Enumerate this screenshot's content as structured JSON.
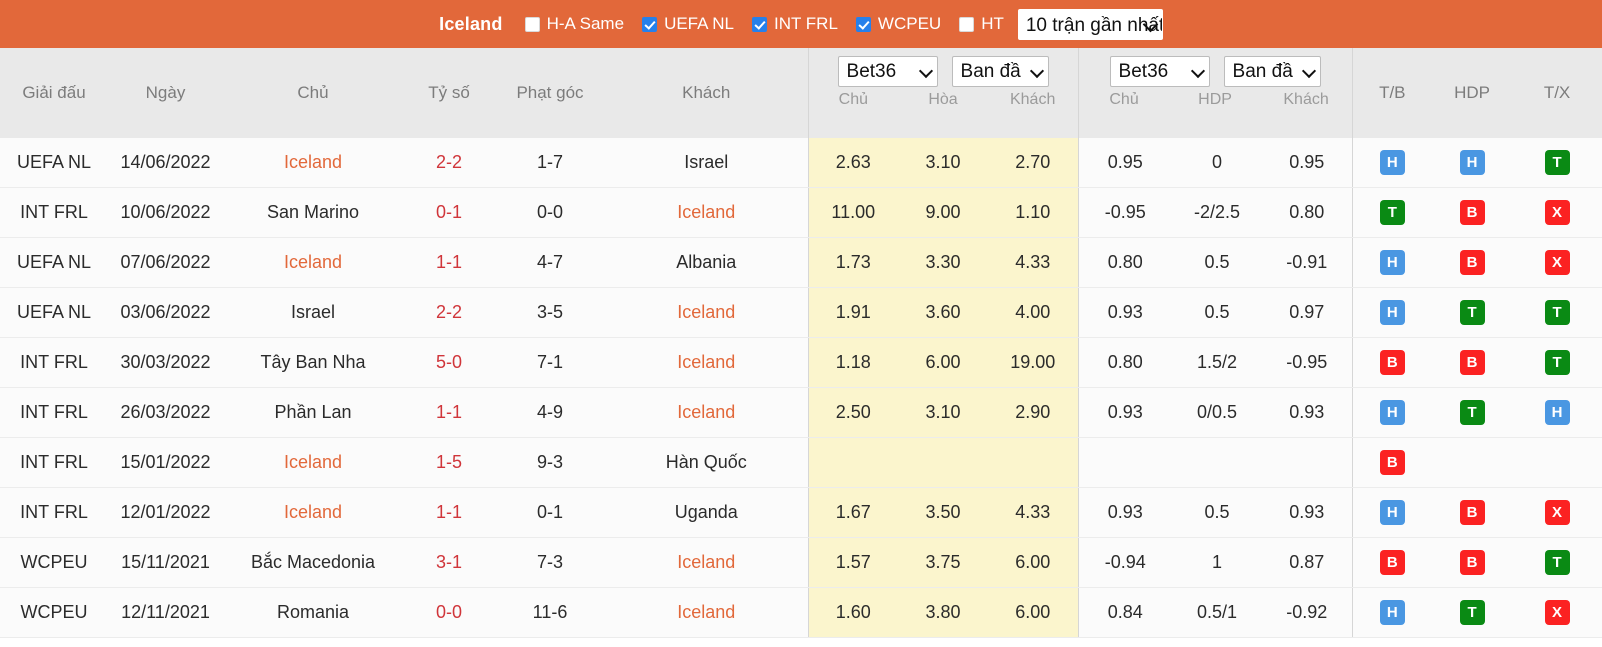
{
  "topbar": {
    "team": "Iceland",
    "filters": [
      {
        "label": "H-A Same",
        "checked": false
      },
      {
        "label": "UEFA NL",
        "checked": true
      },
      {
        "label": "INT FRL",
        "checked": true
      },
      {
        "label": "WCPEU",
        "checked": true
      },
      {
        "label": "HT",
        "checked": false
      }
    ],
    "range_select": "10 trận gần nhất"
  },
  "table": {
    "headers": {
      "league": "Giải đấu",
      "date": "Ngày",
      "home": "Chủ",
      "score": "Tỷ số",
      "corner": "Phạt góc",
      "away": "Khách",
      "tb": "T/B",
      "hdp_res": "HDP",
      "tx": "T/X"
    },
    "group1": {
      "bookmaker": "Bet36",
      "period": "Ban đầ",
      "sub": [
        "Chủ",
        "Hòa",
        "Khách"
      ]
    },
    "group2": {
      "bookmaker": "Bet36",
      "period": "Ban đầ",
      "sub": [
        "Chủ",
        "HDP",
        "Khách"
      ]
    },
    "rows": [
      {
        "league": "UEFA NL",
        "date": "14/06/2022",
        "home": "Iceland",
        "home_hi": true,
        "score": "2-2",
        "corner": "1-7",
        "away": "Israel",
        "away_hi": false,
        "o1": "2.63",
        "ox": "3.10",
        "o2": "2.70",
        "h1": "0.95",
        "hdp": "0",
        "h2": "0.95",
        "tb": "H",
        "hdp_res": "H",
        "tx": "T"
      },
      {
        "league": "INT FRL",
        "date": "10/06/2022",
        "home": "San Marino",
        "home_hi": false,
        "score": "0-1",
        "corner": "0-0",
        "away": "Iceland",
        "away_hi": true,
        "o1": "11.00",
        "ox": "9.00",
        "o2": "1.10",
        "h1": "-0.95",
        "hdp": "-2/2.5",
        "h2": "0.80",
        "tb": "T",
        "hdp_res": "B",
        "tx": "X"
      },
      {
        "league": "UEFA NL",
        "date": "07/06/2022",
        "home": "Iceland",
        "home_hi": true,
        "score": "1-1",
        "corner": "4-7",
        "away": "Albania",
        "away_hi": false,
        "o1": "1.73",
        "ox": "3.30",
        "o2": "4.33",
        "h1": "0.80",
        "hdp": "0.5",
        "h2": "-0.91",
        "tb": "H",
        "hdp_res": "B",
        "tx": "X"
      },
      {
        "league": "UEFA NL",
        "date": "03/06/2022",
        "home": "Israel",
        "home_hi": false,
        "score": "2-2",
        "corner": "3-5",
        "away": "Iceland",
        "away_hi": true,
        "o1": "1.91",
        "ox": "3.60",
        "o2": "4.00",
        "h1": "0.93",
        "hdp": "0.5",
        "h2": "0.97",
        "tb": "H",
        "hdp_res": "T",
        "tx": "T"
      },
      {
        "league": "INT FRL",
        "date": "30/03/2022",
        "home": "Tây Ban Nha",
        "home_hi": false,
        "score": "5-0",
        "corner": "7-1",
        "away": "Iceland",
        "away_hi": true,
        "o1": "1.18",
        "ox": "6.00",
        "o2": "19.00",
        "h1": "0.80",
        "hdp": "1.5/2",
        "h2": "-0.95",
        "tb": "B",
        "hdp_res": "B",
        "tx": "T"
      },
      {
        "league": "INT FRL",
        "date": "26/03/2022",
        "home": "Phần Lan",
        "home_hi": false,
        "score": "1-1",
        "corner": "4-9",
        "away": "Iceland",
        "away_hi": true,
        "o1": "2.50",
        "ox": "3.10",
        "o2": "2.90",
        "h1": "0.93",
        "hdp": "0/0.5",
        "h2": "0.93",
        "tb": "H",
        "hdp_res": "T",
        "tx": "H"
      },
      {
        "league": "INT FRL",
        "date": "15/01/2022",
        "home": "Iceland",
        "home_hi": true,
        "score": "1-5",
        "corner": "9-3",
        "away": "Hàn Quốc",
        "away_hi": false,
        "o1": "",
        "ox": "",
        "o2": "",
        "h1": "",
        "hdp": "",
        "h2": "",
        "tb": "B",
        "hdp_res": "",
        "tx": ""
      },
      {
        "league": "INT FRL",
        "date": "12/01/2022",
        "home": "Iceland",
        "home_hi": true,
        "score": "1-1",
        "corner": "0-1",
        "away": "Uganda",
        "away_hi": false,
        "o1": "1.67",
        "ox": "3.50",
        "o2": "4.33",
        "h1": "0.93",
        "hdp": "0.5",
        "h2": "0.93",
        "tb": "H",
        "hdp_res": "B",
        "tx": "X"
      },
      {
        "league": "WCPEU",
        "date": "15/11/2021",
        "home": "Bắc Macedonia",
        "home_hi": false,
        "score": "3-1",
        "corner": "7-3",
        "away": "Iceland",
        "away_hi": true,
        "o1": "1.57",
        "ox": "3.75",
        "o2": "6.00",
        "h1": "-0.94",
        "hdp": "1",
        "h2": "0.87",
        "tb": "B",
        "hdp_res": "B",
        "tx": "T"
      },
      {
        "league": "WCPEU",
        "date": "12/11/2021",
        "home": "Romania",
        "home_hi": false,
        "score": "0-0",
        "corner": "11-6",
        "away": "Iceland",
        "away_hi": true,
        "o1": "1.60",
        "ox": "3.80",
        "o2": "6.00",
        "h1": "0.84",
        "hdp": "0.5/1",
        "h2": "-0.92",
        "tb": "H",
        "hdp_res": "T",
        "tx": "X"
      }
    ]
  },
  "colors": {
    "accent": "#e2683a",
    "highlight_row": "#fbf5cd",
    "score_red": "#d0353a",
    "badge_blue": "#4a97e2",
    "badge_green": "#0a8a14",
    "badge_red": "#fb2222"
  }
}
